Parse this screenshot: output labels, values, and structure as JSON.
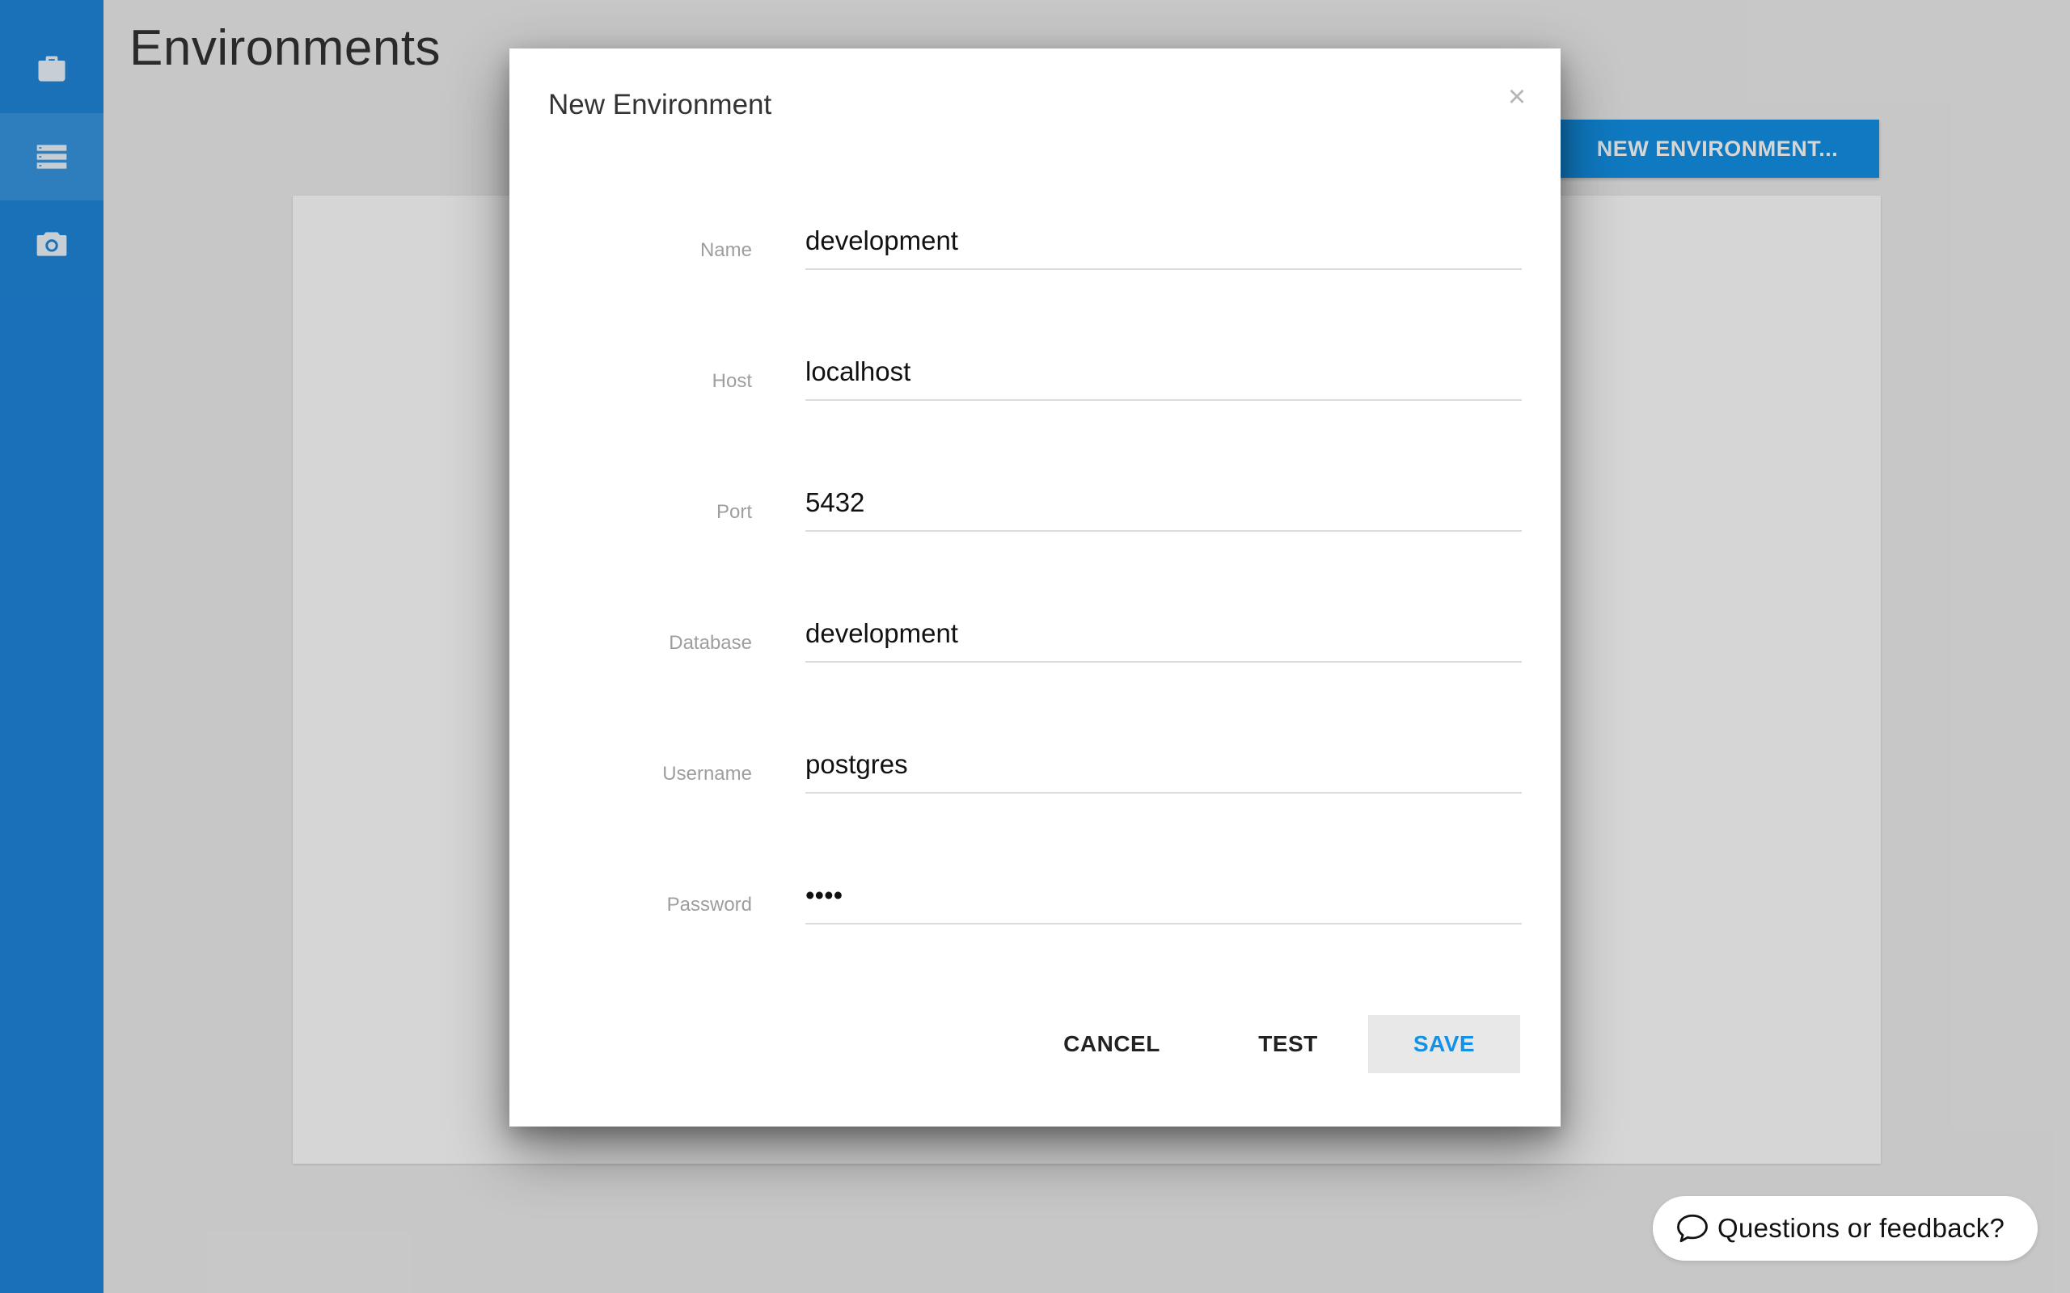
{
  "sidebar": {
    "items": [
      {
        "icon": "briefcase-icon",
        "active": false
      },
      {
        "icon": "list-icon",
        "active": true
      },
      {
        "icon": "camera-icon",
        "active": false
      }
    ]
  },
  "header": {
    "title": "Environments",
    "new_button_label": "NEW ENVIRONMENT..."
  },
  "modal": {
    "title": "New Environment",
    "close_symbol": "×",
    "fields": [
      {
        "label": "Name",
        "value": "development"
      },
      {
        "label": "Host",
        "value": "localhost"
      },
      {
        "label": "Port",
        "value": "5432"
      },
      {
        "label": "Database",
        "value": "development"
      },
      {
        "label": "Username",
        "value": "postgres"
      },
      {
        "label": "Password",
        "value": "••••"
      }
    ],
    "buttons": {
      "cancel": "CANCEL",
      "test": "TEST",
      "save": "SAVE"
    }
  },
  "feedback": {
    "label": "Questions or feedback?",
    "icon": "chat-bubble-icon"
  },
  "colors": {
    "sidebar": "#1f87dc",
    "sidebar_active": "#3796e2",
    "accent": "#1391e6"
  }
}
